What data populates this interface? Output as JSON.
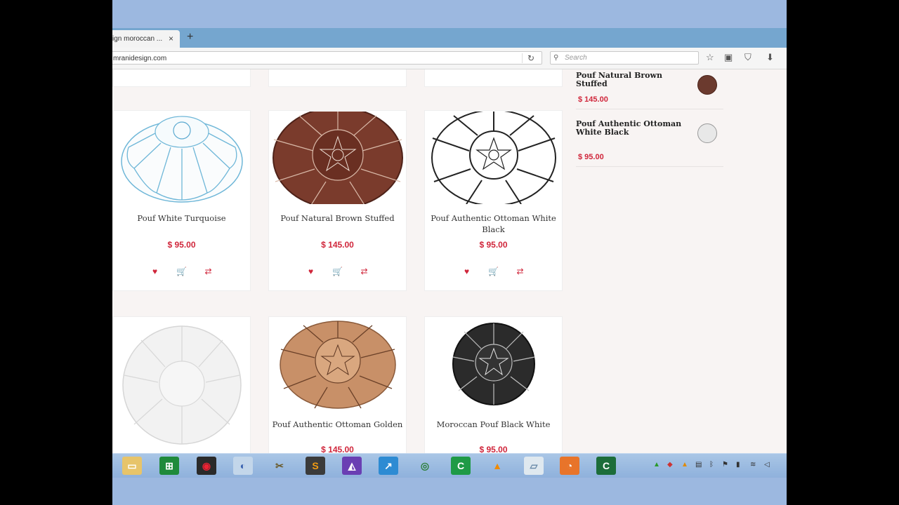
{
  "browser": {
    "tab_title": "ign moroccan ...",
    "tab_close": "×",
    "new_tab": "+",
    "url": "mranidesign.com",
    "reload_icon": "↻",
    "search_placeholder": "Search",
    "toolbar_icons": [
      "star-icon",
      "clipboard-icon",
      "pocket-icon",
      "download-icon"
    ]
  },
  "products": [
    {
      "name": "Pouf White Turquoise",
      "price": "$ 95.00",
      "image": "white-turquoise-pouf"
    },
    {
      "name": "Pouf Natural Brown Stuffed",
      "price": "$ 145.00",
      "image": "brown-pouf"
    },
    {
      "name": "Pouf Authentic Ottoman White Black",
      "price": "$ 95.00",
      "image": "white-black-pouf"
    },
    {
      "name": "",
      "price": "",
      "image": "white-pouf"
    },
    {
      "name": "Pouf Authentic Ottoman Golden",
      "price": "$ 145.00",
      "image": "golden-pouf"
    },
    {
      "name": "Moroccan Pouf Black White",
      "price": "$ 95.00",
      "image": "black-white-pouf"
    }
  ],
  "product_actions": [
    "heart-icon",
    "cart-icon",
    "compare-icon"
  ],
  "sidebar": {
    "items": [
      {
        "name": "Pouf Natural Brown Stuffed",
        "price": "$ 145.00",
        "thumb_color": "#6b3a2e"
      },
      {
        "name": "Pouf Authentic Ottoman White Black",
        "price": "$ 95.00",
        "thumb_color": "#dcdcdc"
      }
    ]
  },
  "taskbar": {
    "apps": [
      "file-explorer",
      "excel",
      "app-red",
      "app-blue-ring",
      "tools",
      "sublime-text",
      "visual-studio",
      "remote-desktop",
      "chrome",
      "camtasia",
      "vlc",
      "notepad",
      "firefox",
      "camtasia-recorder"
    ],
    "colors": {
      "accent": "#d0263b"
    }
  }
}
